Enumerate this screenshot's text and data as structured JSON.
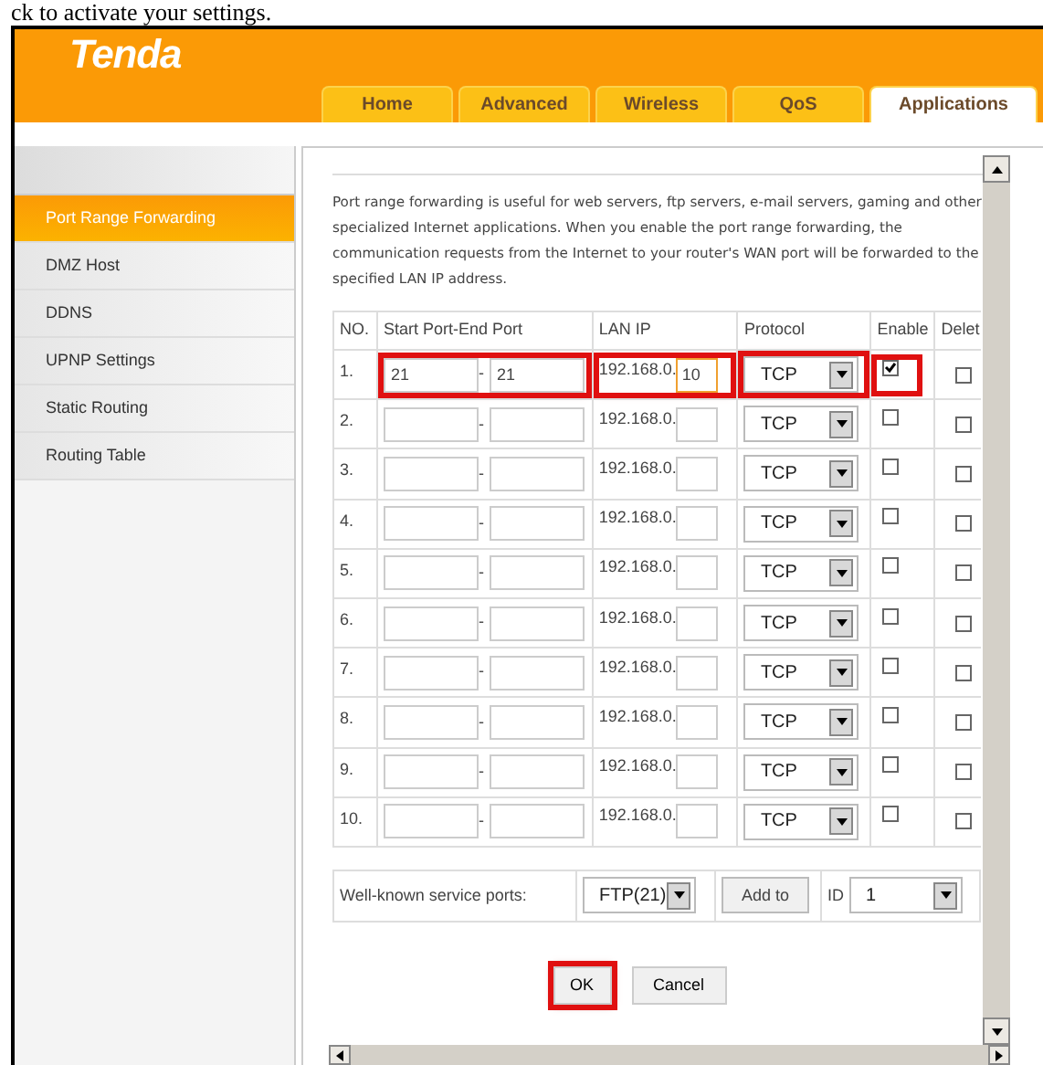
{
  "caption": "ck to activate your settings.",
  "logo": "Tenda",
  "tabs": [
    {
      "label": "Home",
      "selected": false
    },
    {
      "label": "Advanced",
      "selected": false
    },
    {
      "label": "Wireless",
      "selected": false
    },
    {
      "label": "QoS",
      "selected": false
    },
    {
      "label": "Applications",
      "selected": true
    }
  ],
  "sidebar": {
    "items": [
      {
        "label": "Port Range Forwarding",
        "selected": true
      },
      {
        "label": "DMZ Host",
        "selected": false
      },
      {
        "label": "DDNS",
        "selected": false
      },
      {
        "label": "UPNP Settings",
        "selected": false
      },
      {
        "label": "Static Routing",
        "selected": false
      },
      {
        "label": "Routing Table",
        "selected": false
      }
    ]
  },
  "description": "Port range forwarding is useful for web servers, ftp servers, e-mail servers, gaming and other specialized Internet applications. When you enable the port range forwarding, the communication requests from the Internet to your router's WAN port will be forwarded to the specified LAN IP address.",
  "table": {
    "columns": [
      "NO.",
      "Start Port-End Port",
      "LAN IP",
      "Protocol",
      "Enable",
      "Delet"
    ],
    "rows": [
      {
        "no": "1.",
        "start_port": "21",
        "separator": "-",
        "end_port": "21",
        "ip_prefix": "192.168.0.",
        "ip_suffix": "10",
        "protocol": "TCP",
        "enable": true,
        "delete": false,
        "highlighted": true
      },
      {
        "no": "2.",
        "separator": "-",
        "ip_prefix": "192.168.0.",
        "protocol": "TCP",
        "enable": false,
        "delete": false,
        "highlighted": false
      },
      {
        "no": "3.",
        "separator": "-",
        "ip_prefix": "192.168.0.",
        "protocol": "TCP",
        "enable": false,
        "delete": false,
        "highlighted": false
      },
      {
        "no": "4.",
        "separator": "-",
        "ip_prefix": "192.168.0.",
        "protocol": "TCP",
        "enable": false,
        "delete": false,
        "highlighted": false
      },
      {
        "no": "5.",
        "separator": "-",
        "ip_prefix": "192.168.0.",
        "protocol": "TCP",
        "enable": false,
        "delete": false,
        "highlighted": false
      },
      {
        "no": "6.",
        "separator": "-",
        "ip_prefix": "192.168.0.",
        "protocol": "TCP",
        "enable": false,
        "delete": false,
        "highlighted": false
      },
      {
        "no": "7.",
        "separator": "-",
        "ip_prefix": "192.168.0.",
        "protocol": "TCP",
        "enable": false,
        "delete": false,
        "highlighted": false
      },
      {
        "no": "8.",
        "separator": "-",
        "ip_prefix": "192.168.0.",
        "protocol": "TCP",
        "enable": false,
        "delete": false,
        "highlighted": false
      },
      {
        "no": "9.",
        "separator": "-",
        "ip_prefix": "192.168.0.",
        "protocol": "TCP",
        "enable": false,
        "delete": false,
        "highlighted": false
      },
      {
        "no": "10.",
        "separator": "-",
        "ip_prefix": "192.168.0.",
        "protocol": "TCP",
        "enable": false,
        "delete": false,
        "highlighted": false
      }
    ]
  },
  "service_ports": {
    "label": "Well-known service ports:",
    "service": "FTP(21)",
    "add_button": "Add to",
    "id_label": "ID",
    "id_value": "1"
  },
  "buttons": [
    {
      "label": "OK",
      "highlighted": true
    },
    {
      "label": "Cancel",
      "highlighted": false
    }
  ]
}
